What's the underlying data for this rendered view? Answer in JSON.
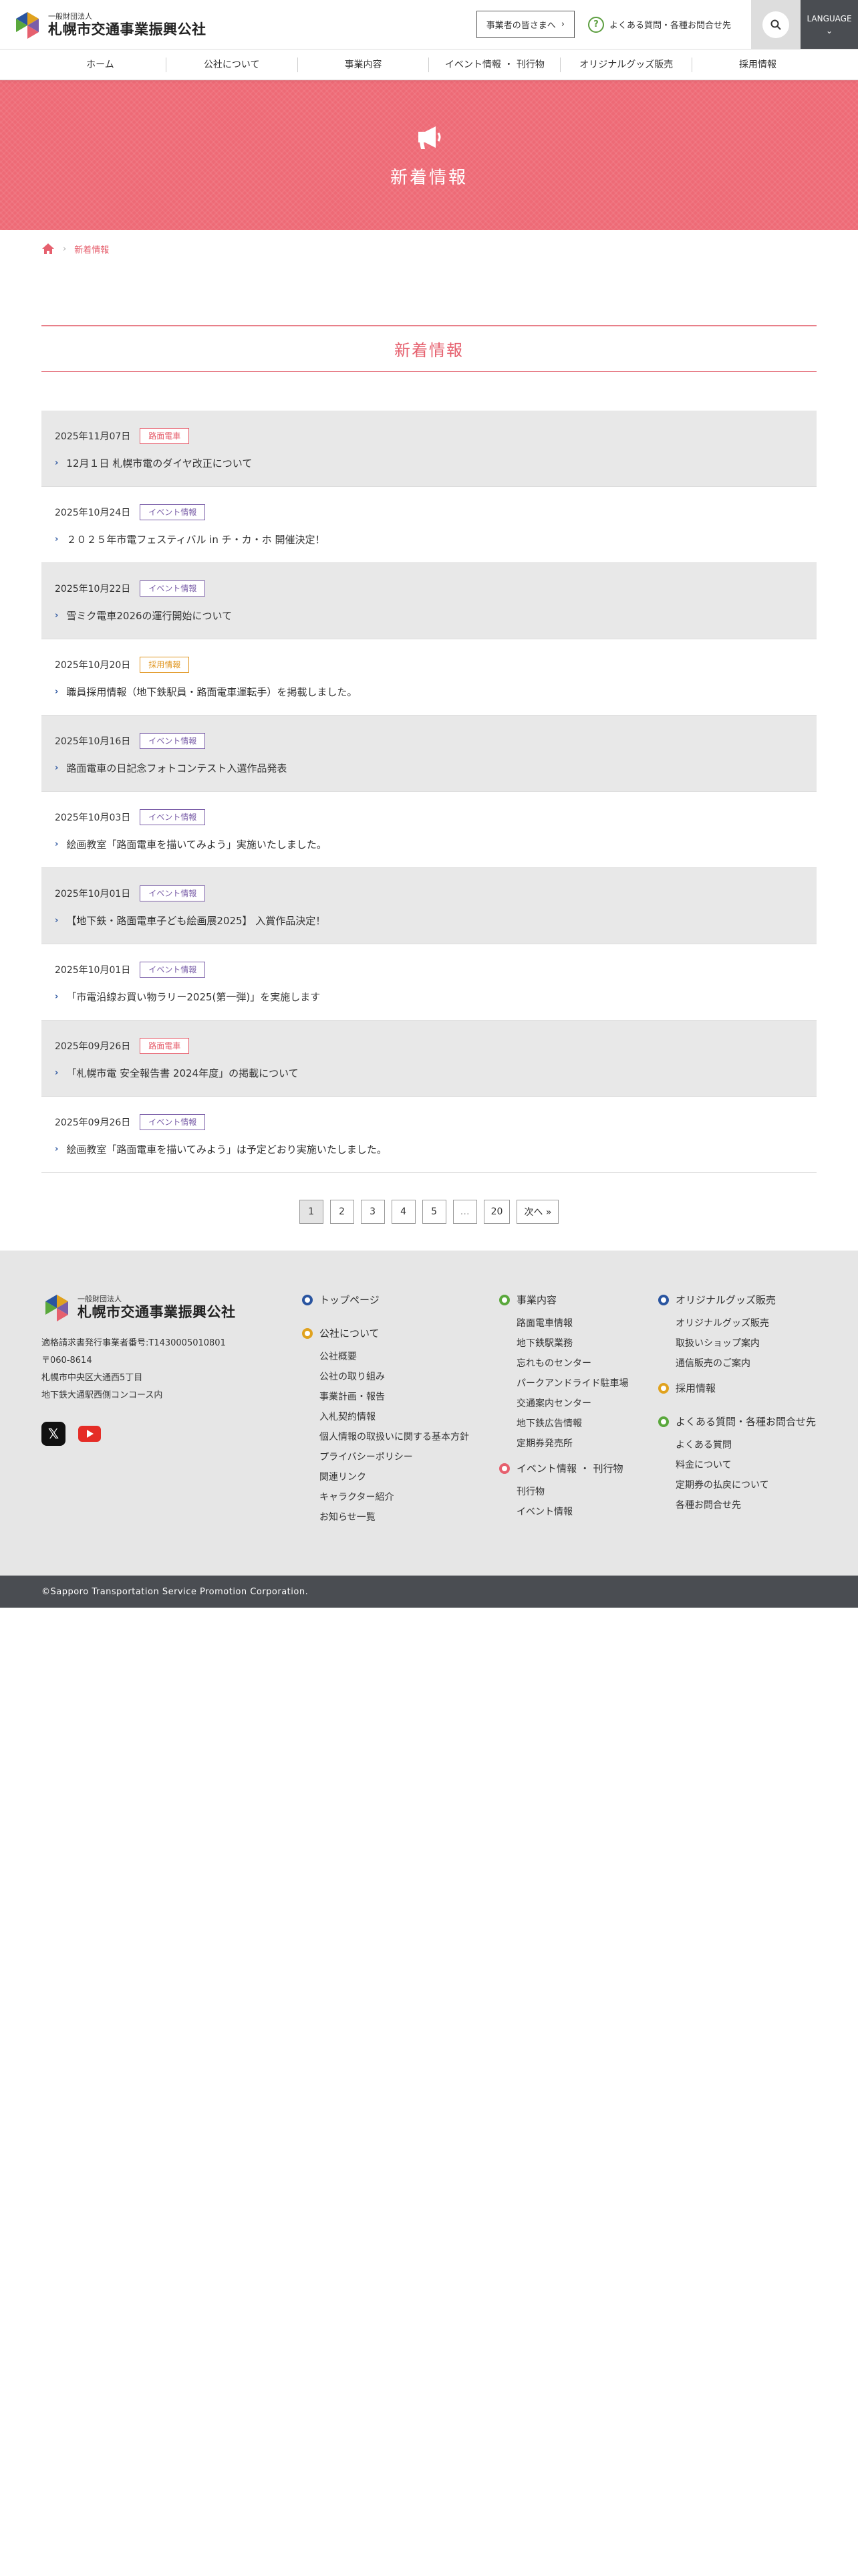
{
  "header": {
    "logo_small": "一般財団法人",
    "logo_big": "札幌市交通事業振興公社",
    "biz_button": "事業者の皆さまへ",
    "faq_link": "よくある質問・各種お問合せ先",
    "language": "LANGUAGE"
  },
  "nav": [
    "ホーム",
    "公社について",
    "事業内容",
    "イベント情報 ・ 刊行物",
    "オリジナルグッズ販売",
    "採用情報"
  ],
  "hero": {
    "title": "新着情報"
  },
  "breadcrumb": {
    "current": "新着情報"
  },
  "section_title": "新着情報",
  "news": [
    {
      "date": "2025年11月07日",
      "tag": "路面電車",
      "tag_color": "#e6606e",
      "title": "12月１日 札幌市電のダイヤ改正について"
    },
    {
      "date": "2025年10月24日",
      "tag": "イベント情報",
      "tag_color": "#7a5ea8",
      "title": "２０２５年市電フェスティバル in チ・カ・ホ 開催決定！"
    },
    {
      "date": "2025年10月22日",
      "tag": "イベント情報",
      "tag_color": "#7a5ea8",
      "title": "雪ミク電車2026の運行開始について"
    },
    {
      "date": "2025年10月20日",
      "tag": "採用情報",
      "tag_color": "#e0951e",
      "title": "職員採用情報（地下鉄駅員・路面電車運転手）を掲載しました。"
    },
    {
      "date": "2025年10月16日",
      "tag": "イベント情報",
      "tag_color": "#7a5ea8",
      "title": "路面電車の日記念フォトコンテスト入選作品発表"
    },
    {
      "date": "2025年10月03日",
      "tag": "イベント情報",
      "tag_color": "#7a5ea8",
      "title": "絵画教室「路面電車を描いてみよう」実施いたしました。"
    },
    {
      "date": "2025年10月01日",
      "tag": "イベント情報",
      "tag_color": "#7a5ea8",
      "title": "【地下鉄・路面電車子ども絵画展2025】 入賞作品決定！"
    },
    {
      "date": "2025年10月01日",
      "tag": "イベント情報",
      "tag_color": "#7a5ea8",
      "title": "「市電沿線お買い物ラリー2025(第一弾)」を実施します"
    },
    {
      "date": "2025年09月26日",
      "tag": "路面電車",
      "tag_color": "#e6606e",
      "title": "「札幌市電 安全報告書 2024年度」の掲載について"
    },
    {
      "date": "2025年09月26日",
      "tag": "イベント情報",
      "tag_color": "#7a5ea8",
      "title": "絵画教室「路面電車を描いてみよう」は予定どおり実施いたしました。"
    }
  ],
  "pagination": {
    "pages": [
      "1",
      "2",
      "3",
      "4",
      "5",
      "…",
      "20"
    ],
    "current": "1",
    "next": "次へ »"
  },
  "footer": {
    "logo_small": "一般財団法人",
    "logo_big": "札幌市交通事業振興公社",
    "invoice": "適格請求書発行事業者番号:T1430005010801",
    "postal": "〒060-8614",
    "address1": "札幌市中央区大通西5丁目",
    "address2": "地下鉄大通駅西側コンコース内",
    "col1": {
      "h1": "トップページ",
      "h2": "公社について",
      "items": [
        "公社概要",
        "公社の取り組み",
        "事業計画・報告",
        "入札契約情報",
        "個人情報の取扱いに関する基本方針",
        "プライバシーポリシー",
        "関連リンク",
        "キャラクター紹介",
        "お知らせ一覧"
      ]
    },
    "col2": {
      "h1": "事業内容",
      "items1": [
        "路面電車情報",
        "地下鉄駅業務",
        "忘れものセンター",
        "パークアンドライド駐車場",
        "交通案内センター",
        "地下鉄広告情報",
        "定期券発売所"
      ],
      "h2": "イベント情報 ・ 刊行物",
      "items2": [
        "刊行物",
        "イベント情報"
      ]
    },
    "col3": {
      "h1": "オリジナルグッズ販売",
      "items1": [
        "オリジナルグッズ販売",
        "取扱いショップ案内",
        "通信販売のご案内"
      ],
      "h2": "採用情報",
      "h3": "よくある質問・各種お問合せ先",
      "items3": [
        "よくある質問",
        "料金について",
        "定期券の払戻について",
        "各種お問合せ先"
      ]
    },
    "copyright": "©Sapporo Transportation Service Promotion Corporation."
  }
}
